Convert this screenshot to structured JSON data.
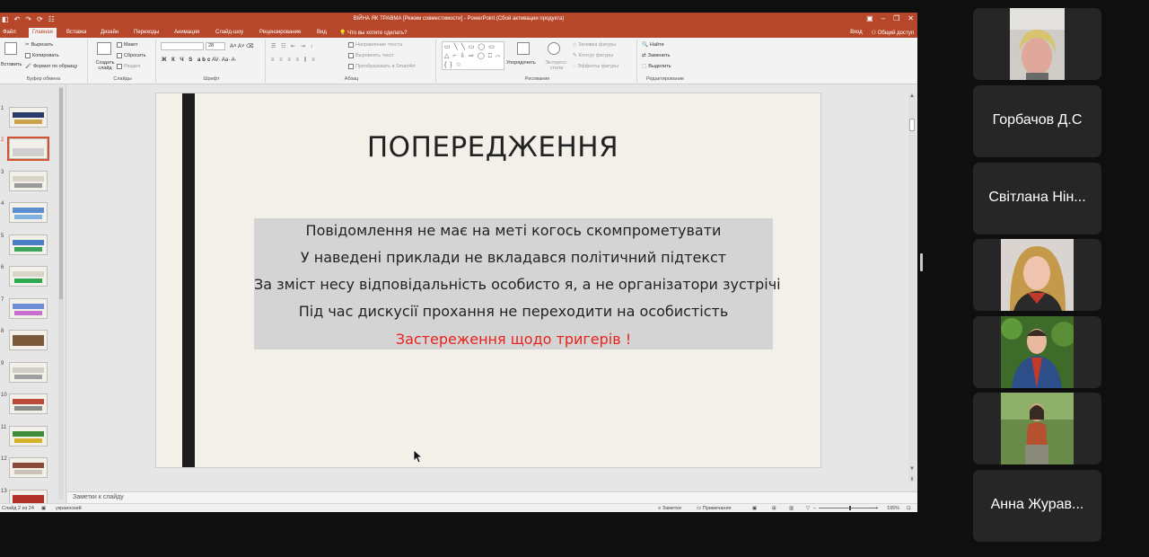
{
  "app": {
    "title": "ВІЙНА ЯК ТРАВМА [Режим совместимости] - PowerPoint (Сбой активации продукта)",
    "quick_access": [
      "◧",
      "↶",
      "↷",
      "⟳",
      "☷"
    ],
    "window_controls": [
      "▣",
      "–",
      "❐",
      "✕"
    ]
  },
  "ribbon_tabs": [
    "Файл",
    "Главная",
    "Вставка",
    "Дизайн",
    "Переходы",
    "Анимация",
    "Слайд-шоу",
    "Рецензирование",
    "Вид"
  ],
  "ribbon_tabs_active": "Главная",
  "tell_me": "Что вы хотите сделать?",
  "ribbon_right": {
    "signin": "Вход",
    "share": "Общий доступ"
  },
  "ribbon": {
    "clipboard": {
      "paste": "Вставить",
      "cut": "Вырезать",
      "copy": "Копировать",
      "format": "Формат по образцу",
      "label": "Буфер обмена"
    },
    "slides": {
      "new": "Создать слайд",
      "layout": "Макет",
      "reset": "Сбросить",
      "section": "Раздел",
      "label": "Слайды"
    },
    "font": {
      "size": "28",
      "buttons": "Ж К Ч S abc",
      "label": "Шрифт"
    },
    "paragraph": {
      "text_dir": "Направление текста",
      "align": "Выровнять текст",
      "smartart": "Преобразовать в SmartArt",
      "label": "Абзац"
    },
    "drawing": {
      "arrange": "Упорядочить",
      "styles": "Экспресс-стили",
      "fill": "Заливка фигуры",
      "outline": "Контур фигуры",
      "effects": "Эффекты фигуры",
      "shapes": "▭ ╲ ╲ ▭ ◯ ▭ △ ⌐ ⇩ ⇨ ◯ ⎕ ⌒ { } ☆",
      "label": "Рисование"
    },
    "editing": {
      "find": "Найти",
      "replace": "Заменить",
      "select": "Выделить",
      "label": "Редактирование"
    }
  },
  "thumbnails": {
    "numbers": [
      "1",
      "2",
      "3",
      "4",
      "5",
      "6",
      "7",
      "8",
      "9",
      "10",
      "11",
      "12",
      "13"
    ],
    "active": "2"
  },
  "slide": {
    "title": "ПОПЕРЕДЖЕННЯ",
    "lines": [
      "Повідомлення не має на меті когось скомпрометувати",
      "У наведені приклади не вкладався політичний підтекст",
      "За зміст несу відповідальність особисто я, а не організатори зустрічі",
      "Під час дискусії прохання не переходити на особистість"
    ],
    "warning": "Застереження щодо тригерів !"
  },
  "notes_placeholder": "Заметки к слайду",
  "status": {
    "slide": "Слайд 2 из 24",
    "language": "украинский",
    "notes": "Заметки",
    "comments": "Примечания",
    "zoom": "195%"
  },
  "participants": [
    {
      "type": "video",
      "name": ""
    },
    {
      "type": "name",
      "name": "Горбачов Д.С"
    },
    {
      "type": "name",
      "name": "Світлана Нін..."
    },
    {
      "type": "video",
      "name": ""
    },
    {
      "type": "video",
      "name": ""
    },
    {
      "type": "video",
      "name": ""
    },
    {
      "type": "name",
      "name": "Анна Журав..."
    }
  ],
  "colors": {
    "ppt_accent": "#b7472a",
    "warning_text": "#e8231b",
    "tile_bg": "#262626",
    "slide_bg": "#f3efe9"
  }
}
